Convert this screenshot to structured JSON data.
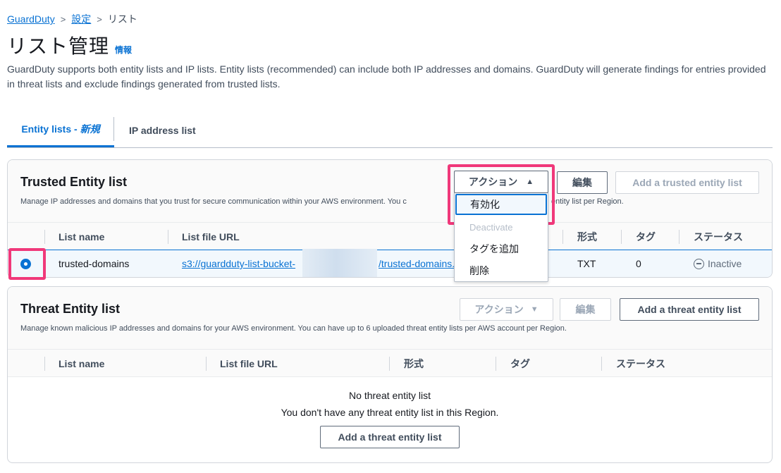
{
  "breadcrumb": {
    "root": "GuardDuty",
    "settings": "設定",
    "current": "リスト",
    "separator": ">"
  },
  "page": {
    "title": "リスト管理",
    "info_link": "情報",
    "description": "GuardDuty supports both entity lists and IP lists. Entity lists (recommended) can include both IP addresses and domains. GuardDuty will generate findings for entries provided in threat lists and exclude findings generated from trusted lists."
  },
  "tabs": [
    {
      "label": "Entity lists - ",
      "badge": "新規"
    },
    {
      "label": "IP address list"
    }
  ],
  "trusted": {
    "title": "Trusted Entity list",
    "subtitle_left": "Manage IP addresses and domains that you trust for secure communication within your AWS environment. You c",
    "subtitle_right": "entity list per Region.",
    "actions_label": "アクション",
    "actions_caret": "▲",
    "edit_label": "編集",
    "add_label": "Add a trusted entity list",
    "columns": [
      "List name",
      "List file URL",
      "形式",
      "タグ",
      "ステータス"
    ],
    "row": {
      "name": "trusted-domains",
      "url_left": "s3://guardduty-list-bucket-",
      "url_right": "/trusted-domains.",
      "format": "TXT",
      "tags": "0",
      "status": "Inactive"
    },
    "menu": [
      "有効化",
      "Deactivate",
      "タグを追加",
      "削除"
    ]
  },
  "threat": {
    "title": "Threat Entity list",
    "subtitle": "Manage known malicious IP addresses and domains for your AWS environment. You can have up to 6 uploaded threat entity lists per AWS account per Region.",
    "actions_label": "アクション",
    "actions_caret": "▼",
    "edit_label": "編集",
    "add_label": "Add a threat entity list",
    "columns": [
      "List name",
      "List file URL",
      "形式",
      "タグ",
      "ステータス"
    ],
    "empty_title": "No threat entity list",
    "empty_text": "You don't have any threat entity list in this Region.",
    "empty_button": "Add a threat entity list"
  },
  "colors": {
    "link": "#0972d3",
    "highlight": "#f0387a"
  }
}
